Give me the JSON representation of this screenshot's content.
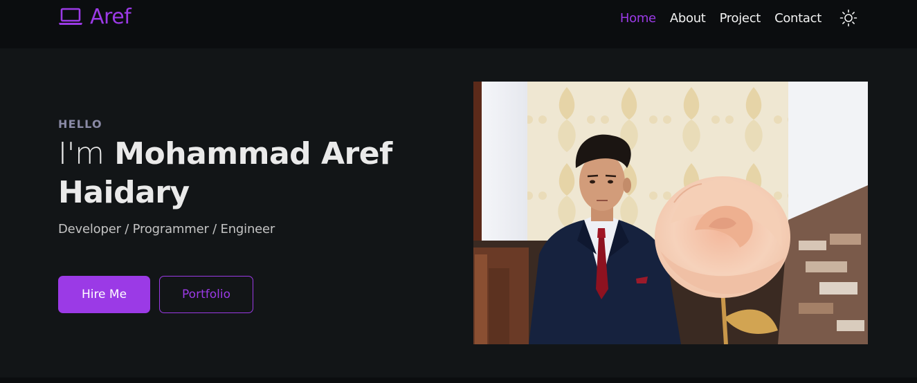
{
  "brand": {
    "name": "Aref",
    "icon": "laptop-icon",
    "color": "#9b3ae6"
  },
  "nav": {
    "items": [
      {
        "label": "Home",
        "active": true
      },
      {
        "label": "About",
        "active": false
      },
      {
        "label": "Project",
        "active": false
      },
      {
        "label": "Contact",
        "active": false
      }
    ],
    "theme_toggle_icon": "sun-icon"
  },
  "hero": {
    "eyebrow": "HELLO",
    "intro": "I'm",
    "name": "Mohammad Aref Haidary",
    "roles": "Developer / Programmer / Engineer",
    "primary_button": "Hire Me",
    "secondary_button": "Portfolio"
  },
  "colors": {
    "accent": "#9b3ae6",
    "background": "#121517",
    "navbar": "#0b0d0f"
  }
}
